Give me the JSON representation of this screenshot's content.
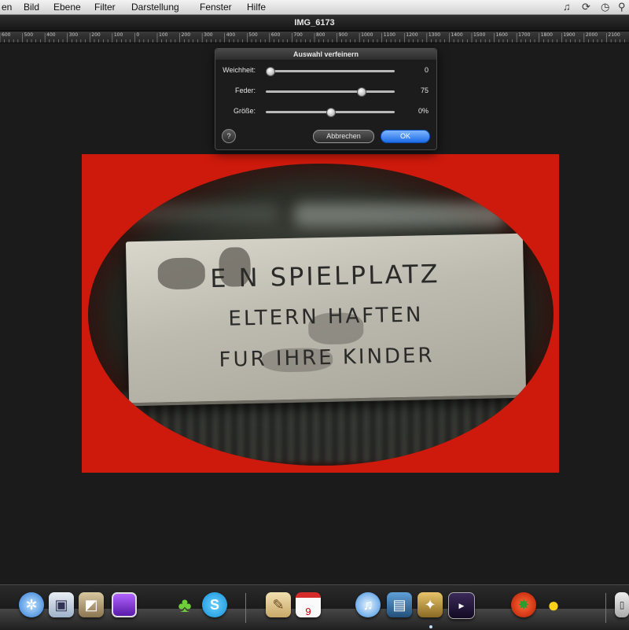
{
  "menubar": {
    "items": [
      "en",
      "Bild",
      "Ebene",
      "Filter",
      "Darstellung",
      "Fenster",
      "Hilfe"
    ],
    "status_icons": [
      "music-note-icon",
      "sync-icon",
      "time-machine-icon",
      "search-icon"
    ]
  },
  "window": {
    "title": "IMG_6173"
  },
  "ruler": {
    "labels": [
      "600",
      "500",
      "400",
      "300",
      "200",
      "100",
      "0",
      "100",
      "200",
      "300",
      "400",
      "500",
      "600",
      "700",
      "800",
      "900",
      "1000",
      "1100",
      "1200",
      "1300",
      "1400",
      "1500",
      "1600",
      "1700",
      "1800",
      "1900",
      "2000",
      "2100"
    ]
  },
  "dialog": {
    "title": "Auswahl verfeinern",
    "rows": [
      {
        "label": "Weichheit:",
        "value": "0",
        "level": 0.0
      },
      {
        "label": "Feder:",
        "value": "75",
        "level": 0.75
      },
      {
        "label": "Größe:",
        "value": "0%",
        "level": 0.5
      }
    ],
    "cancel_label": "Abbrechen",
    "ok_label": "OK",
    "help_icon": "help-icon",
    "accent_color": "#1c6ce6"
  },
  "photo": {
    "sign_lines": [
      "E N SPIELPLATZ",
      "ELTERN HAFTEN",
      "FUR IHRE KINDER"
    ],
    "border_color": "#ce1a0c"
  },
  "dock": {
    "icons": [
      "safari-icon",
      "preview-icon",
      "photo-browser-icon",
      "purple-app-icon",
      "adium-duck-icon",
      "skype-icon",
      "notes-icon",
      "calendar-icon",
      "itunes-icon",
      "iphoto-icon",
      "pixelmator-icon",
      "frontrow-icon",
      "vlc-icon",
      "cyberduck-icon",
      "trash-icon"
    ],
    "calendar_day": "9"
  }
}
